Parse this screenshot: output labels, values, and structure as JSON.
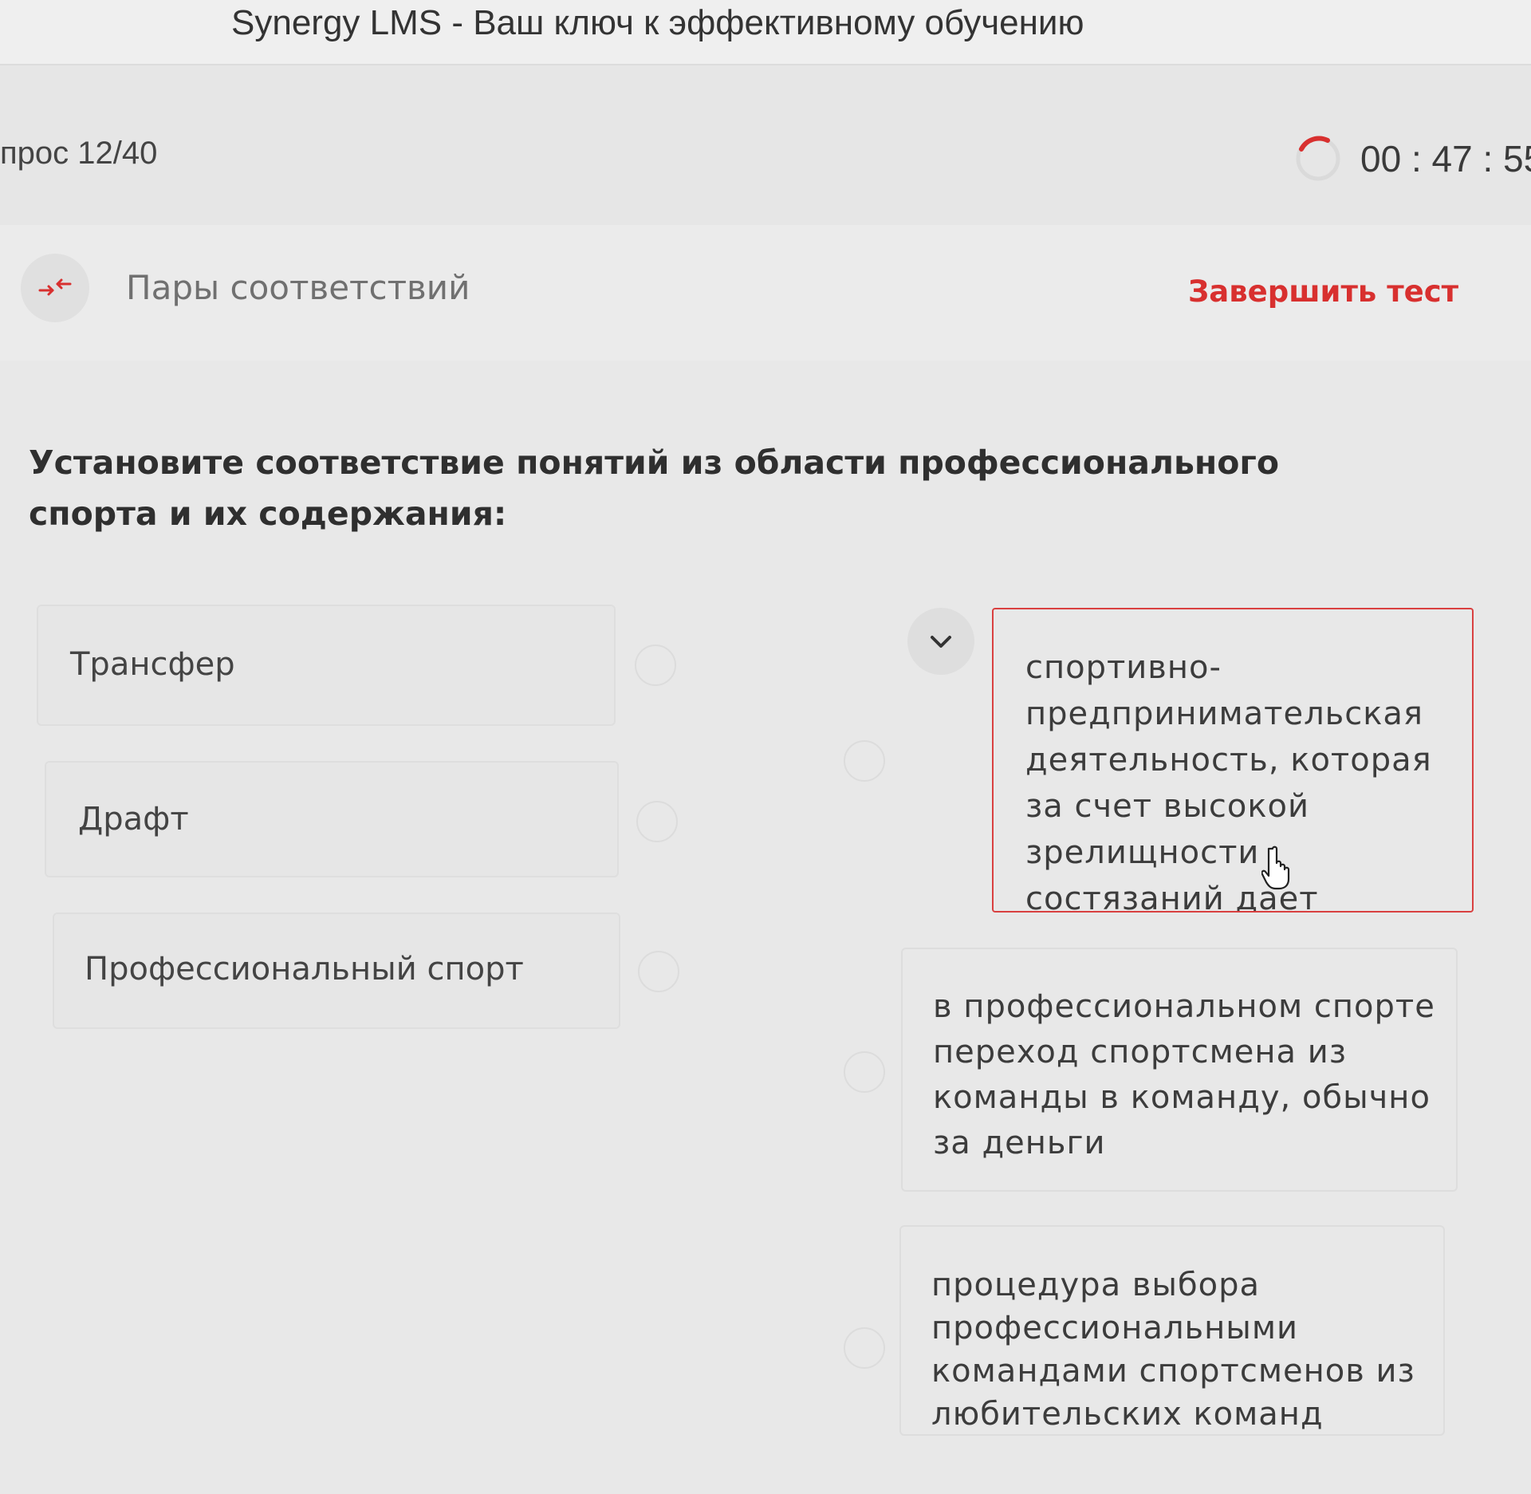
{
  "window": {
    "title": "Synergy LMS - Ваш ключ к эффективному обучению"
  },
  "header": {
    "question_counter": "прос 12/40",
    "timer": "00 : 47 : 55"
  },
  "typebar": {
    "type_label": "Пары соответствий",
    "finish_label": "Завершить тест",
    "type_icon": "swap-arrows-icon"
  },
  "question": {
    "text": "Установите соответствие понятий из области профессионального спорта и их содержания:"
  },
  "terms": [
    {
      "label": "Трансфер"
    },
    {
      "label": "Драфт"
    },
    {
      "label": "Профессиональный спорт"
    }
  ],
  "definitions": [
    {
      "text": "спортивно-предпринимательская деятельность, которая за счет высокой зрелищности состязаний дает",
      "selected": true
    },
    {
      "text": "в профессиональном спорте переход спортсмена из команды в команду, обычно за деньги",
      "selected": false
    },
    {
      "text": "процедура выбора профессиональными командами спортсменов из любительских команд",
      "selected": false
    }
  ],
  "colors": {
    "accent_red": "#d8302f",
    "selected_border": "#d94040",
    "background": "#e8e8e8"
  },
  "icons": {
    "dropdown": "chevron-down-icon",
    "cursor": "hand-pointer-icon",
    "timer": "timer-ring-icon"
  }
}
